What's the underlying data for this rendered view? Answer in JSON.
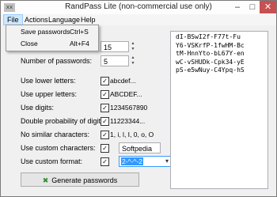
{
  "window": {
    "app_icon": "xx",
    "title": "RandPass Lite (non-commercial use only)",
    "min": "–",
    "max": "□",
    "close": "✕"
  },
  "menubar": {
    "file": "File",
    "actions": "Actions",
    "language": "Language",
    "help": "Help"
  },
  "file_menu": {
    "save": {
      "label": "Save passwords",
      "shortcut": "Ctrl+S"
    },
    "close": {
      "label": "Close",
      "shortcut": "Alt+F4"
    }
  },
  "form": {
    "length_value": "15",
    "count_label": "Number of passwords:",
    "count_value": "5",
    "lower_label": "Use lower letters:",
    "lower_example": "abcdef...",
    "upper_label": "Use upper letters:",
    "upper_example": "ABCDEF...",
    "digits_label": "Use digits:",
    "digits_example": "1234567890",
    "double_label": "Double probability of digits:",
    "double_example": "11223344...",
    "similar_label": "No similar characters:",
    "similar_example": "1, i, l, I, 0, o, O",
    "custom_chars_label": "Use custom characters:",
    "custom_chars_value": "Softpedia",
    "custom_format_label": "Use custom format:",
    "custom_format_value": "2-^-^-2",
    "check_mark": "✓",
    "spin_up": "▲",
    "spin_down": "▼",
    "combo_arrow": "▾",
    "generate_label": "Generate passwords",
    "generate_icon": "✖"
  },
  "output": {
    "lines": [
      "dI-BSwI2f-F77t-Fu",
      "Y6-VSKrfP-1fwHM-Bc",
      "tM-HnnYto-bL67Y-en",
      "wC-vSHUDk-Cpk34-yE",
      "pS-e5wNuy-C4Ypq-hS"
    ]
  }
}
